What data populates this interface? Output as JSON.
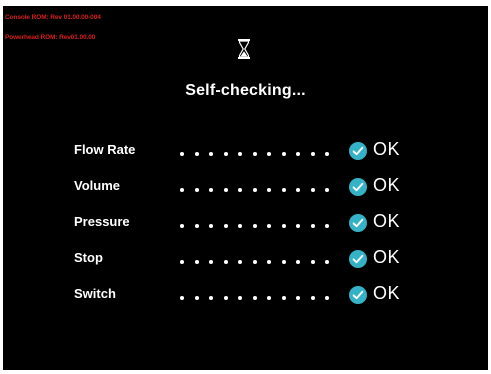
{
  "rom_info": {
    "console": "Console ROM: Rev 01.00.00-004",
    "powerhead": "Powerhead ROM: Rev01.00.00"
  },
  "status": {
    "icon": "hourglass-icon",
    "title": "Self-checking..."
  },
  "checks": [
    {
      "label": "Flow Rate",
      "result": "OK"
    },
    {
      "label": "Volume",
      "result": "OK"
    },
    {
      "label": "Pressure",
      "result": "OK"
    },
    {
      "label": "Stop",
      "result": "OK"
    },
    {
      "label": "Switch",
      "result": "OK"
    }
  ],
  "colors": {
    "background": "#000000",
    "rom_text": "#d81e1e",
    "check_accent": "#35b3c6",
    "text": "#ffffff"
  }
}
